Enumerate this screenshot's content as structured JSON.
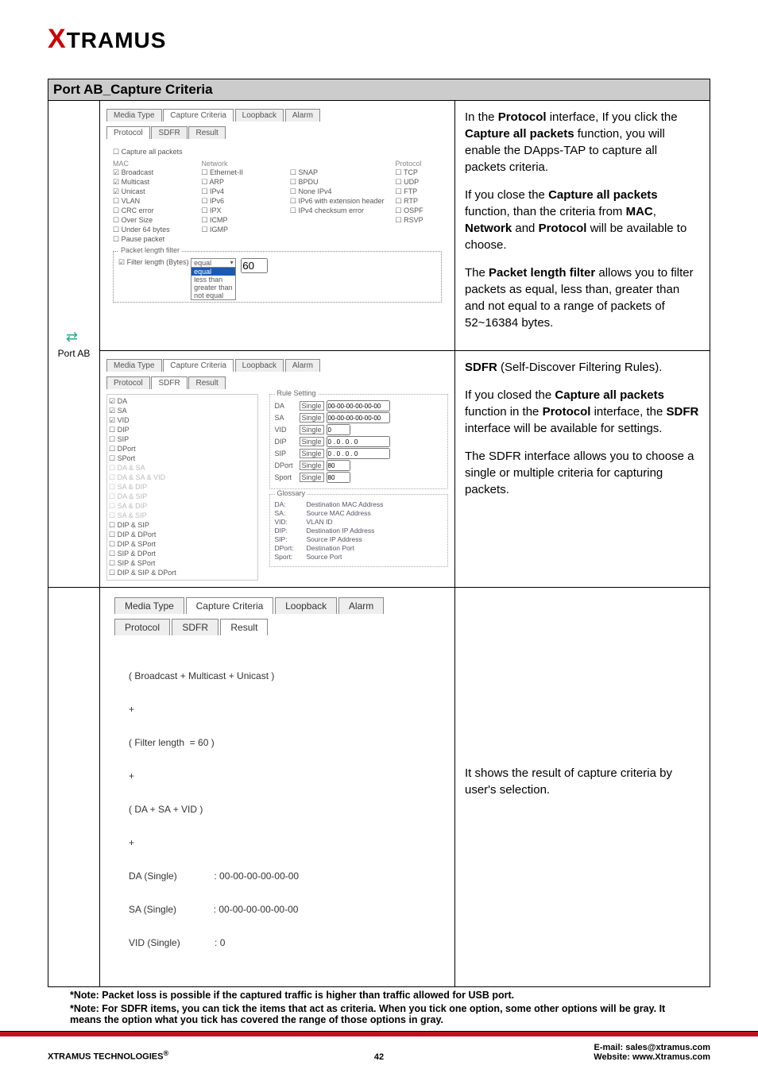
{
  "brand": "TRAMUS",
  "section_title": "Port AB_Capture Criteria",
  "port_label": "Port AB",
  "row1": {
    "tabs": [
      "Media Type",
      "Capture Criteria",
      "Loopback",
      "Alarm"
    ],
    "sub_tabs": [
      "Protocol",
      "SDFR",
      "Result"
    ],
    "capture_all": "Capture all packets",
    "mac_header": "MAC",
    "net_header": "Network",
    "proto_header": "Protocol",
    "mac_items": [
      "Broadcast",
      "Multicast",
      "Unicast",
      "VLAN",
      "CRC error",
      "Over Size",
      "Under 64 bytes",
      "Pause packet"
    ],
    "net_items1": [
      "Ethernet-II",
      "ARP",
      "IPv4",
      "IPv6",
      "IPX",
      "ICMP",
      "IGMP"
    ],
    "net_items2": [
      "SNAP",
      "BPDU",
      "None IPv4",
      "IPv6 with extension header",
      "IPv4 checksum error"
    ],
    "proto_items": [
      "TCP",
      "UDP",
      "FTP",
      "RTP",
      "OSPF",
      "RSVP"
    ],
    "pktfilter_legend": "Packet length filter",
    "filter_label": "Filter length (Bytes)",
    "filter_sel": "equal",
    "filter_options": [
      "equal",
      "less than",
      "greater than",
      "not equal"
    ],
    "filter_val": "60",
    "desc_parts": {
      "p1a": "In the ",
      "p1b": "Protocol",
      "p1c": " interface, If you click the ",
      "p1d": "Capture all packets",
      "p1e": " function, you will enable the DApps-TAP to capture all packets criteria.",
      "p2a": "If you close the ",
      "p2b": "Capture all packets",
      "p2c": " function, than the criteria from ",
      "p2d": "MAC",
      "p2e": ", ",
      "p2f": "Network",
      "p2g": " and ",
      "p2h": "Protocol",
      "p2i": " will be available to choose.",
      "p3a": "The ",
      "p3b": "Packet length filter",
      "p3c": " allows you to filter packets as equal, less than, greater than and not equal to a range of packets of 52~16384 bytes."
    }
  },
  "row2": {
    "sdfr_items": [
      "DA",
      "SA",
      "VID",
      "DIP",
      "SIP",
      "DPort",
      "SPort",
      "DA & SA",
      "DA & SA & VID",
      "SA & DIP",
      "DA & SIP",
      "SA & DIP",
      "SA & SIP",
      "DIP & SIP",
      "DIP & DPort",
      "DIP & SPort",
      "SIP & DPort",
      "SIP & SPort",
      "DIP & SIP & DPort"
    ],
    "rule_setting": "Rule Setting",
    "rule_da": "DA",
    "rule_sa": "SA",
    "rule_vid": "VID",
    "rule_dip": "DIP",
    "rule_sip": "SIP",
    "rule_dport": "DPort",
    "rule_sport": "Sport",
    "opt_single": "Single",
    "mac_val": "00-00-00-00-00-00",
    "vid_val": "0",
    "ip_val": "0 . 0 . 0 . 0",
    "port_val": "80",
    "glossary": "Glossary",
    "gloss": {
      "da": "Destination MAC Address",
      "sa": "Source MAC Address",
      "vid": "VLAN ID",
      "dip": "Destination IP Address",
      "sip": "Source IP Address",
      "dport": "Destination Port",
      "sport": "Source Port"
    },
    "desc_parts": {
      "p1a": "SDFR",
      "p1b": " (Self-Discover Filtering Rules).",
      "p2a": "If you closed the ",
      "p2b": "Capture all packets",
      "p2c": " function in the ",
      "p2d": "Protocol",
      "p2e": " interface, the ",
      "p2f": "SDFR",
      "p2g": " interface will be available for settings.",
      "p3": "The SDFR interface allows you to choose a single or multiple criteria for capturing packets."
    }
  },
  "row3": {
    "tabs": [
      "Media Type",
      "Capture Criteria",
      "Loopback",
      "Alarm"
    ],
    "sub_tabs": [
      "Protocol",
      "SDFR",
      "Result"
    ],
    "result_lines": [
      "( Broadcast + Multicast + Unicast )",
      "+",
      "( Filter length  = 60 )",
      "+",
      "( DA + SA + VID )",
      "+",
      "DA (Single)              : 00-00-00-00-00-00",
      "SA (Single)              : 00-00-00-00-00-00",
      "VID (Single)             : 0"
    ],
    "desc": "It shows the result of capture criteria by user's selection."
  },
  "notes": [
    "*Note: Packet loss is possible if the captured traffic is higher than traffic allowed for USB port.",
    "*Note: For SDFR items, you can tick the items that act as criteria. When you tick one option, some other options will be gray. It means the option what you tick has covered the range of those options in gray."
  ],
  "footer": {
    "left": "XTRAMUS TECHNOLOGIES",
    "reg": "®",
    "page": "42",
    "email_label": "E-mail: ",
    "email": "sales@xtramus.com",
    "web_label": "Website:  ",
    "web": "www.Xtramus.com"
  }
}
